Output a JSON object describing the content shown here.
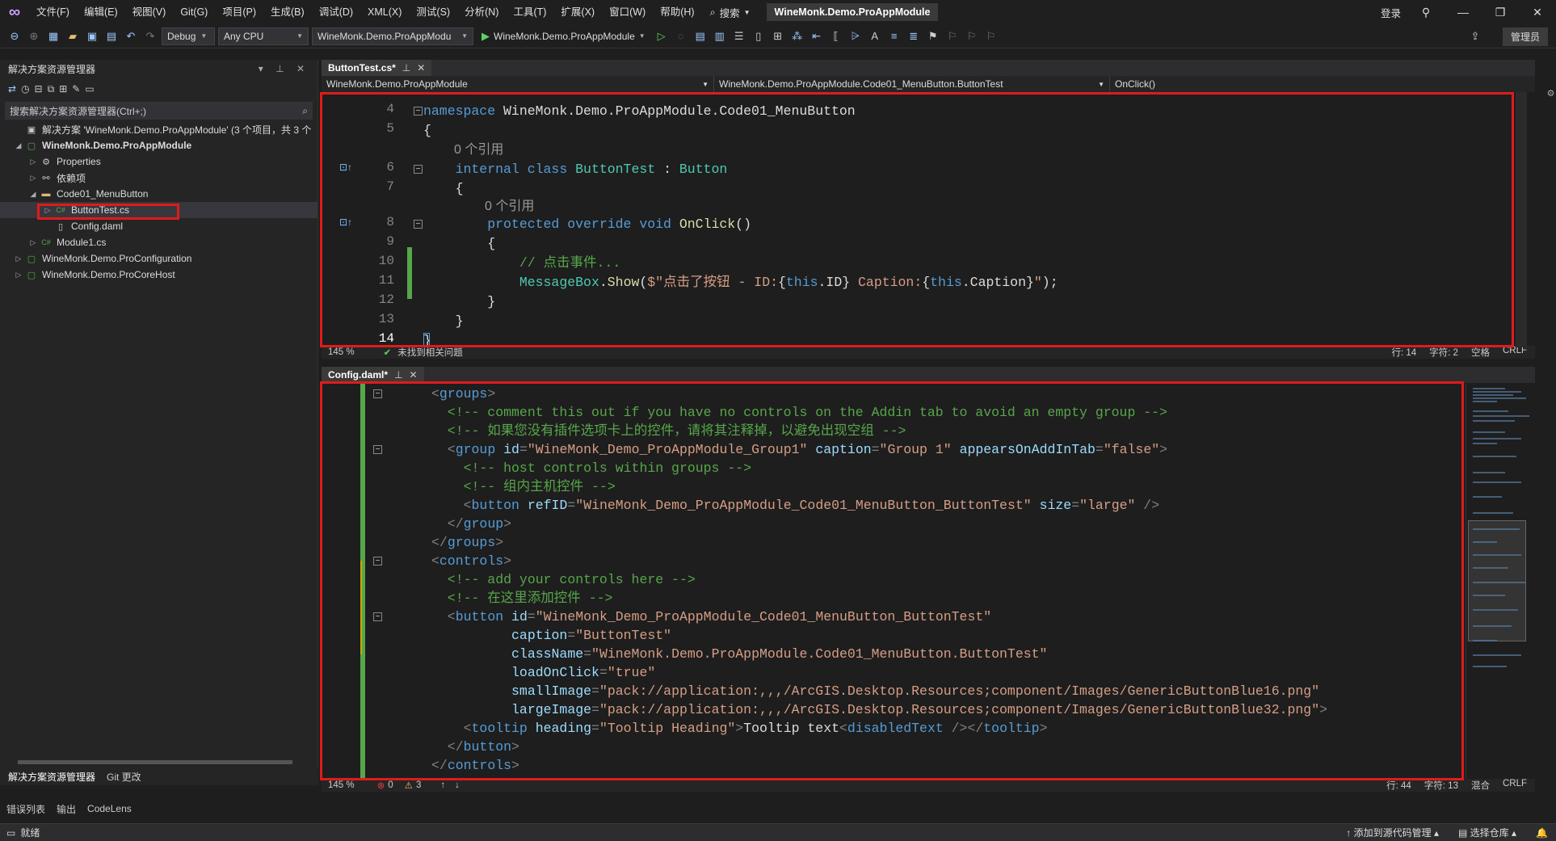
{
  "titlebar": {
    "menu": [
      "文件(F)",
      "编辑(E)",
      "视图(V)",
      "Git(G)",
      "项目(P)",
      "生成(B)",
      "调试(D)",
      "XML(X)",
      "测试(S)",
      "分析(N)",
      "工具(T)",
      "扩展(X)",
      "窗口(W)",
      "帮助(H)"
    ],
    "search_label": "搜索",
    "solution_name": "WineMonk.Demo.ProAppModule",
    "login": "登录",
    "admin": "管理员"
  },
  "toolbar": {
    "config": "Debug",
    "platform": "Any CPU",
    "startup_project": "WineMonk.Demo.ProAppModu",
    "run_label": "WineMonk.Demo.ProAppModule"
  },
  "solution_explorer": {
    "title": "解决方案资源管理器",
    "search_placeholder": "搜索解决方案资源管理器(Ctrl+;)",
    "tree": [
      {
        "label": "解决方案 'WineMonk.Demo.ProAppModule' (3 个项目，共 3 个",
        "icon": "solution-icon",
        "level": 0,
        "arrow": "",
        "bold": false
      },
      {
        "label": "WineMonk.Demo.ProAppModule",
        "icon": "csharp-project-icon",
        "level": 0,
        "arrow": "open",
        "bold": true
      },
      {
        "label": "Properties",
        "icon": "properties-icon",
        "level": 1,
        "arrow": "closed",
        "bold": false
      },
      {
        "label": "依赖项",
        "icon": "dependencies-icon",
        "level": 1,
        "arrow": "closed",
        "bold": false
      },
      {
        "label": "Code01_MenuButton",
        "icon": "folder-icon",
        "level": 1,
        "arrow": "open",
        "bold": false
      },
      {
        "label": "ButtonTest.cs",
        "icon": "csharp-file-icon",
        "level": 2,
        "arrow": "closed",
        "bold": false,
        "selected": true
      },
      {
        "label": "Config.daml",
        "icon": "file-icon",
        "level": 2,
        "arrow": "",
        "bold": false
      },
      {
        "label": "Module1.cs",
        "icon": "csharp-file-icon",
        "level": 1,
        "arrow": "closed",
        "bold": false
      },
      {
        "label": "WineMonk.Demo.ProConfiguration",
        "icon": "csharp-project-icon",
        "level": 0,
        "arrow": "closed",
        "bold": false
      },
      {
        "label": "WineMonk.Demo.ProCoreHost",
        "icon": "csharp-project-icon",
        "level": 0,
        "arrow": "closed",
        "bold": false
      }
    ],
    "bottom_tabs": [
      "解决方案资源管理器",
      "Git 更改"
    ]
  },
  "tool_tabs": [
    "错误列表",
    "输出",
    "CodeLens"
  ],
  "editor_top": {
    "tab": "ButtonTest.cs*",
    "nav_project": "WineMonk.Demo.ProAppModule",
    "nav_class": "WineMonk.Demo.ProAppModule.Code01_MenuButton.ButtonTest",
    "nav_member": "OnClick()",
    "zoom": "145 %",
    "issues": "未找到相关问题",
    "line": "行: 14",
    "col": "字符: 2",
    "indent": "空格",
    "eol": "CRLF",
    "codelens_0": "0 个引用",
    "codelens_1": "0 个引用"
  },
  "editor_bottom": {
    "tab": "Config.daml*",
    "zoom": "145 %",
    "errors": "0",
    "warnings": "3",
    "line": "行: 44",
    "col": "字符: 13",
    "indent": "混合",
    "eol": "CRLF"
  },
  "statusbar": {
    "ready": "就绪",
    "add_source_control": "添加到源代码管理",
    "select_repo": "选择仓库"
  },
  "colors": {
    "highlight_box": "#e01b1b",
    "change_bar": "#57a64a"
  }
}
